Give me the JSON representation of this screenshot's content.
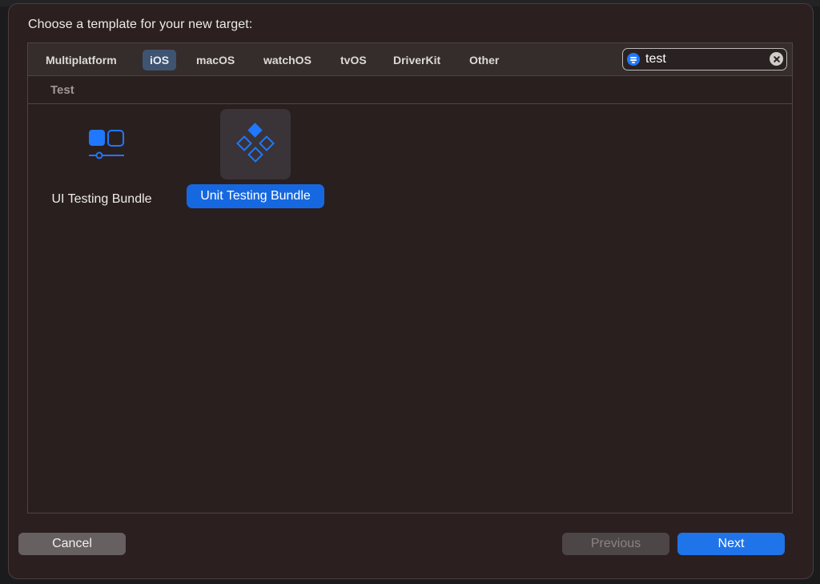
{
  "dialog": {
    "title": "Choose a template for your new target:"
  },
  "tabs": [
    {
      "label": "Multiplatform",
      "selected": false
    },
    {
      "label": "iOS",
      "selected": true
    },
    {
      "label": "macOS",
      "selected": false
    },
    {
      "label": "watchOS",
      "selected": false
    },
    {
      "label": "tvOS",
      "selected": false
    },
    {
      "label": "DriverKit",
      "selected": false
    },
    {
      "label": "Other",
      "selected": false
    }
  ],
  "search": {
    "value": "test",
    "icon": "filter-icon",
    "clear_icon": "clear-icon"
  },
  "section": {
    "title": "Test"
  },
  "templates": [
    {
      "label": "UI Testing Bundle",
      "icon": "ui-testing-bundle-icon",
      "selected": false
    },
    {
      "label": "Unit Testing Bundle",
      "icon": "unit-testing-bundle-icon",
      "selected": true
    }
  ],
  "buttons": {
    "cancel": "Cancel",
    "previous": "Previous",
    "next": "Next"
  },
  "colors": {
    "accent": "#1f74ea",
    "icon_blue": "#1f78ff",
    "dialog_bg": "#2b1f1f"
  }
}
